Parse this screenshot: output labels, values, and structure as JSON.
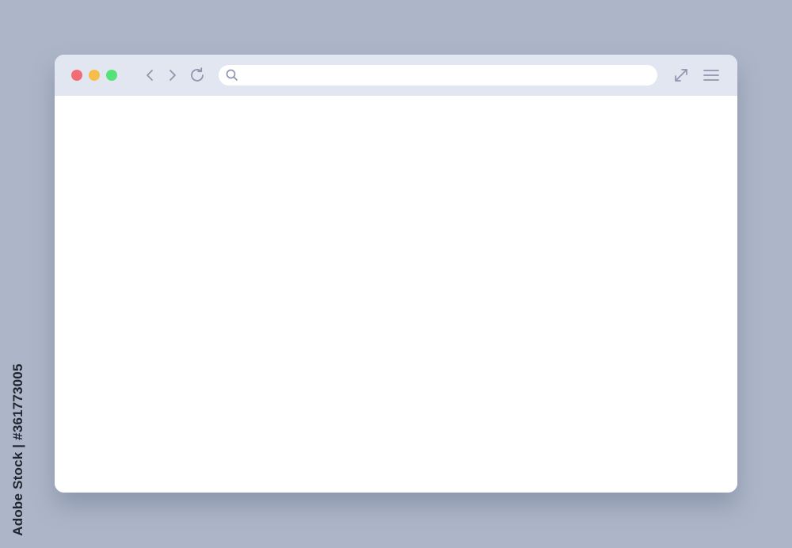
{
  "colors": {
    "background": "#adb6c8",
    "toolbar": "#e1e6f1",
    "content": "#ffffff",
    "icon": "#8e97ad",
    "close": "#f26d73",
    "minimize": "#f7bd4a",
    "maximize": "#56e27a"
  },
  "icons": {
    "back": "chevron-left-icon",
    "forward": "chevron-right-icon",
    "reload": "reload-icon",
    "search": "search-icon",
    "expand": "expand-icon",
    "menu": "hamburger-menu-icon"
  },
  "address_bar": {
    "value": "",
    "placeholder": ""
  },
  "watermark": {
    "stock_id": "Adobe Stock | #361773005"
  }
}
